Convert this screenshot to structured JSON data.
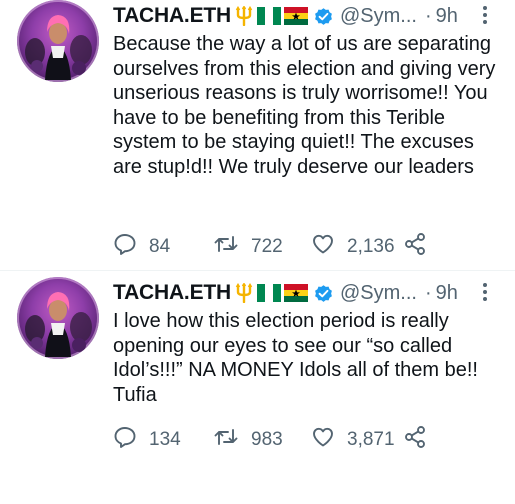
{
  "tweets": [
    {
      "name": "TACHA.ETH",
      "handle": "@Sym...",
      "dot": "·",
      "time": "9h",
      "text": "Because the way a lot of us are separating ourselves from this election and giving very unserious reasons is truly worrisome!! You have to be benefiting from this Terible system to be staying quiet!! The excuses are stup!d!! We truly deserve our leaders",
      "replies": "84",
      "retweets": "722",
      "likes": "2,136"
    },
    {
      "name": "TACHA.ETH",
      "handle": "@Sym...",
      "dot": "·",
      "time": "9h",
      "text": "I love how this election period is really opening our eyes to see our “so called Idol’s!!!” NA MONEY Idols all of them be!! Tufia",
      "replies": "134",
      "retweets": "983",
      "likes": "3,871"
    }
  ],
  "icons": {
    "name_emojis": [
      "trident-emoji",
      "nigeria-flag-emoji",
      "ghana-flag-emoji"
    ],
    "verified": "verified-badge-icon",
    "actions": [
      "reply-icon",
      "retweet-icon",
      "like-icon",
      "share-icon"
    ],
    "more": "more-icon"
  },
  "colors": {
    "text": "#0f1419",
    "secondary": "#536471",
    "verified": "#1d9bf0",
    "divider": "#eff3f4",
    "trident": "#f5b400",
    "nigeria_green": "#008751",
    "ghana_red": "#ce1126",
    "ghana_gold": "#fcd116",
    "ghana_green": "#006b3f"
  }
}
